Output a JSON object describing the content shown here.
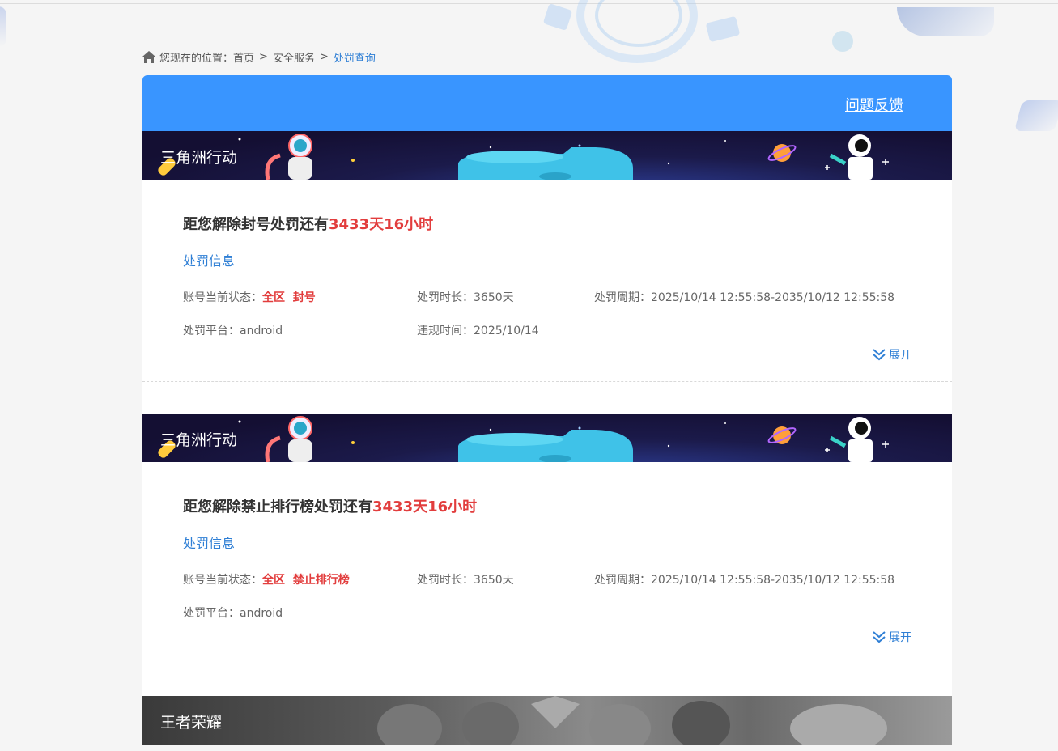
{
  "breadcrumb": {
    "prefix": "您现在的位置：",
    "items": [
      "首页",
      "安全服务"
    ],
    "current": "处罚查询",
    "separator": ">"
  },
  "header": {
    "feedback_label": "问题反馈"
  },
  "cards": [
    {
      "game": "三角洲行动",
      "countdown_prefix": "距您解除封号处罚还有",
      "countdown_value": "3433天16小时",
      "section_label": "处罚信息",
      "status_label": "账号当前状态：",
      "status_value": "全区  封号",
      "duration_label": "处罚时长：",
      "duration_value": "3650天",
      "period_label": "处罚周期：",
      "period_value": "2025/10/14 12:55:58-2035/10/12 12:55:58",
      "platform_label": "处罚平台：",
      "platform_value": "android",
      "violation_label": "违规时间：",
      "violation_value": "2025/10/14",
      "expand_label": "展开"
    },
    {
      "game": "三角洲行动",
      "countdown_prefix": "距您解除禁止排行榜处罚还有",
      "countdown_value": "3433天16小时",
      "section_label": "处罚信息",
      "status_label": "账号当前状态：",
      "status_value": "全区  禁止排行榜",
      "duration_label": "处罚时长：",
      "duration_value": "3650天",
      "period_label": "处罚周期：",
      "period_value": "2025/10/14 12:55:58-2035/10/12 12:55:58",
      "platform_label": "处罚平台：",
      "platform_value": "android",
      "expand_label": "展开"
    },
    {
      "game": "王者荣耀"
    }
  ],
  "colors": {
    "header_blue": "#3995ff",
    "link_blue": "#2f7fd5",
    "highlight_red": "#e23d3d"
  },
  "icons": {
    "home": "home-icon",
    "expand": "double-chevron-down-icon"
  }
}
